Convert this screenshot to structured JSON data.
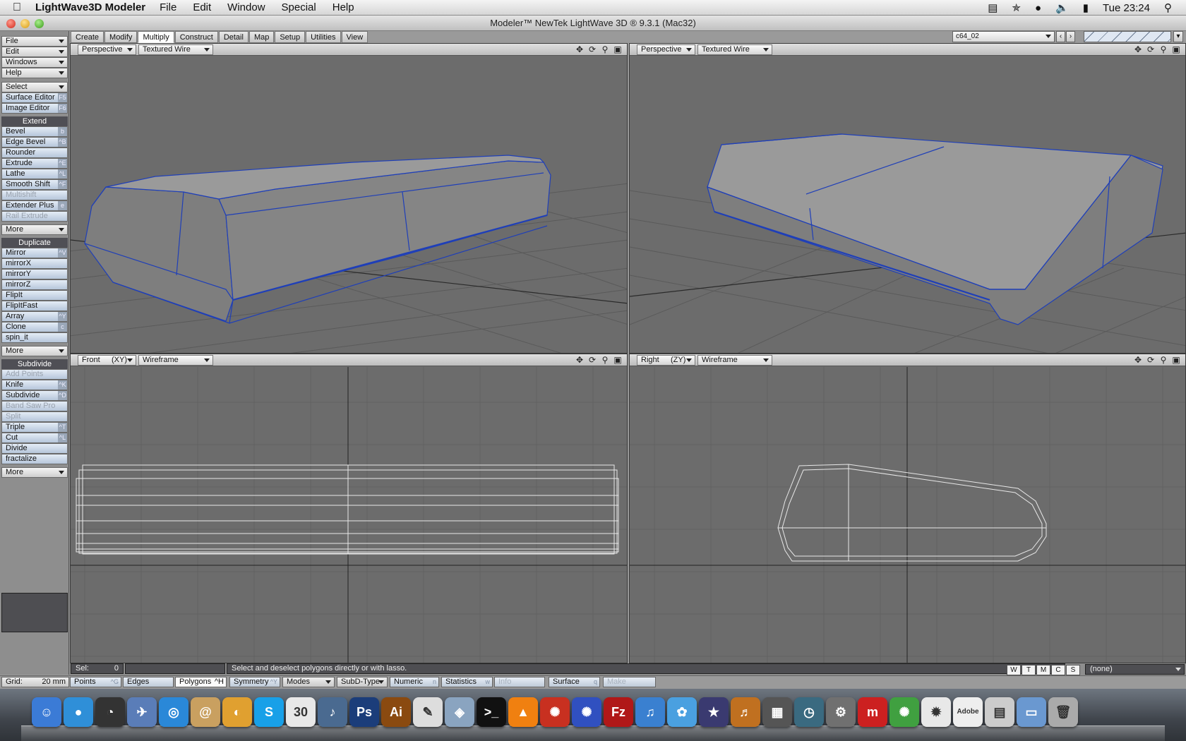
{
  "menubar": {
    "app_name": "LightWave3D Modeler",
    "items": [
      "File",
      "Edit",
      "Window",
      "Special",
      "Help"
    ],
    "clock": "Tue 23:24"
  },
  "window": {
    "title": "Modeler™ NewTek LightWave 3D ® 9.3.1 (Mac32)"
  },
  "left_panel": {
    "top_menus": [
      "File",
      "Edit",
      "Windows",
      "Help"
    ],
    "select": "Select",
    "surface_editor": "Surface Editor",
    "surface_editor_key": "F5",
    "image_editor": "Image Editor",
    "image_editor_key": "F6",
    "extend_header": "Extend",
    "extend_items": [
      {
        "label": "Bevel",
        "key": "b"
      },
      {
        "label": "Edge Bevel",
        "key": "^B"
      },
      {
        "label": "Rounder",
        "key": ""
      },
      {
        "label": "Extrude",
        "key": "^E"
      },
      {
        "label": "Lathe",
        "key": "^L"
      },
      {
        "label": "Smooth Shift",
        "key": "^F"
      },
      {
        "label": "Multishift",
        "key": ""
      },
      {
        "label": "Extender Plus",
        "key": "e"
      },
      {
        "label": "Rail Extrude",
        "key": ""
      }
    ],
    "more": "More",
    "duplicate_header": "Duplicate",
    "duplicate_items": [
      {
        "label": "Mirror",
        "key": "^V"
      },
      {
        "label": "mirrorX",
        "key": ""
      },
      {
        "label": "mirrorY",
        "key": ""
      },
      {
        "label": "mirrorZ",
        "key": ""
      },
      {
        "label": "FlipIt",
        "key": ""
      },
      {
        "label": "FlipItFast",
        "key": ""
      },
      {
        "label": "Array",
        "key": "^Y"
      },
      {
        "label": "Clone",
        "key": "c"
      },
      {
        "label": "spin_it",
        "key": ""
      }
    ],
    "subdivide_header": "Subdivide",
    "subdivide_items": [
      {
        "label": "Add Points",
        "key": ""
      },
      {
        "label": "Knife",
        "key": "^K"
      },
      {
        "label": "Subdivide",
        "key": "^D"
      },
      {
        "label": "Band Saw Pro",
        "key": ""
      },
      {
        "label": "Split",
        "key": ""
      },
      {
        "label": "Triple",
        "key": "^T"
      },
      {
        "label": "Cut",
        "key": "^L"
      },
      {
        "label": "Divide",
        "key": ""
      },
      {
        "label": "fractalize",
        "key": ""
      }
    ]
  },
  "tabs": [
    "Create",
    "Modify",
    "Multiply",
    "Construct",
    "Detail",
    "Map",
    "Setup",
    "Utilities",
    "View"
  ],
  "active_tab": "Multiply",
  "layer_combo": "c64_02",
  "viewports": {
    "tl": {
      "view": "Perspective",
      "mode": "Textured Wire"
    },
    "tr": {
      "view": "Perspective",
      "mode": "Textured Wire"
    },
    "bl": {
      "view": "Front",
      "axis": "(XY)",
      "mode": "Wireframe"
    },
    "br": {
      "view": "Right",
      "axis": "(ZY)",
      "mode": "Wireframe"
    }
  },
  "status": {
    "sel_label": "Sel:",
    "sel_value": "0",
    "message": "Select and deselect polygons directly or with lasso.",
    "wtmcs": [
      "W",
      "T",
      "M",
      "C",
      "S"
    ],
    "none": "(none)"
  },
  "bottom_bar": {
    "grid_label": "Grid:",
    "grid_value": "20 mm",
    "points": "Points",
    "points_key": "^G",
    "edges": "Edges",
    "polygons": "Polygons",
    "polygons_key": "^H",
    "symmetry": "Symmetry",
    "symmetry_key": "^Y",
    "modes": "Modes",
    "subd_type": "SubD-Type",
    "numeric": "Numeric",
    "numeric_key": "n",
    "statistics": "Statistics",
    "statistics_key": "w",
    "info": "Info",
    "surface": "Surface",
    "surface_key": "q",
    "make": "Make"
  },
  "colors": {
    "wire_blue": "#1f3fb8",
    "viewport_bg": "#6c6c6c",
    "grid": "#5e5e5e"
  },
  "dock": [
    "finder-icon",
    "messenger-icon",
    "dashboard-icon",
    "mail-bird-icon",
    "safari-icon",
    "address-book-icon",
    "mindmap-icon",
    "skype-icon",
    "ical-icon",
    "itunes-globe-icon",
    "photoshop-icon",
    "illustrator-icon",
    "textedit-icon",
    "preview-icon",
    "terminal-icon",
    "vlc-icon",
    "lightwave-layout-icon",
    "lightwave-modeler-icon",
    "filezilla-icon",
    "itunes-icon",
    "iphoto-icon",
    "imovie-icon",
    "garageband-icon",
    "dashboard2-icon",
    "time-machine-icon",
    "system-prefs-icon",
    "mamp-icon",
    "lightwave-hub-icon",
    "app-icon",
    "adobe-icon",
    "documents-icon",
    "folder-icon",
    "trash-icon"
  ]
}
